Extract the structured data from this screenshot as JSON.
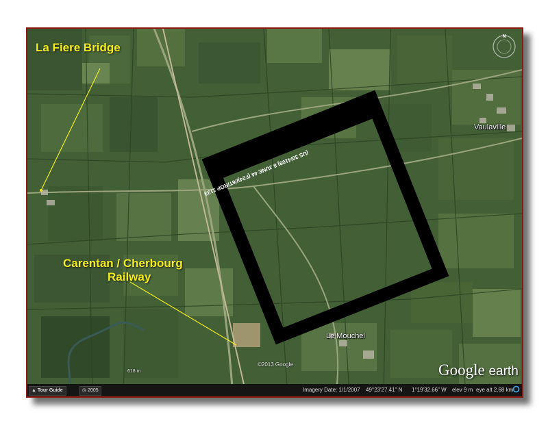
{
  "labels": {
    "la_fiere": "La Fiere Bridge",
    "railway_line1": "Carentan / Cherbourg",
    "railway_line2": "Railway",
    "vaulaville": "Vaulaville",
    "le_mouchel": "Le Mouchel"
  },
  "photo_caption": "(US 30/4109) 8 JUNE 44 (F24)//6T/RGP    1133",
  "copyright": "©2013 Google",
  "scale_text": "618 m",
  "logo": {
    "google": "Google",
    "earth": "earth"
  },
  "statusbar": {
    "tour_guide": "Tour Guide",
    "historical": "2005",
    "imagery_date": "Imagery Date: 1/1/2007",
    "latitude": "49°23'27.41\" N",
    "longitude": "1°19'32.66\" W",
    "elevation": "elev   9 m",
    "eye_alt": "eye alt  2.68 km"
  },
  "colors": {
    "callout_yellow": "#f2ec1d",
    "frame_border": "#8b1a12",
    "photo_frame": "#000000"
  },
  "icons": {
    "compass": "compass-icon",
    "status": "status-ring-icon"
  }
}
